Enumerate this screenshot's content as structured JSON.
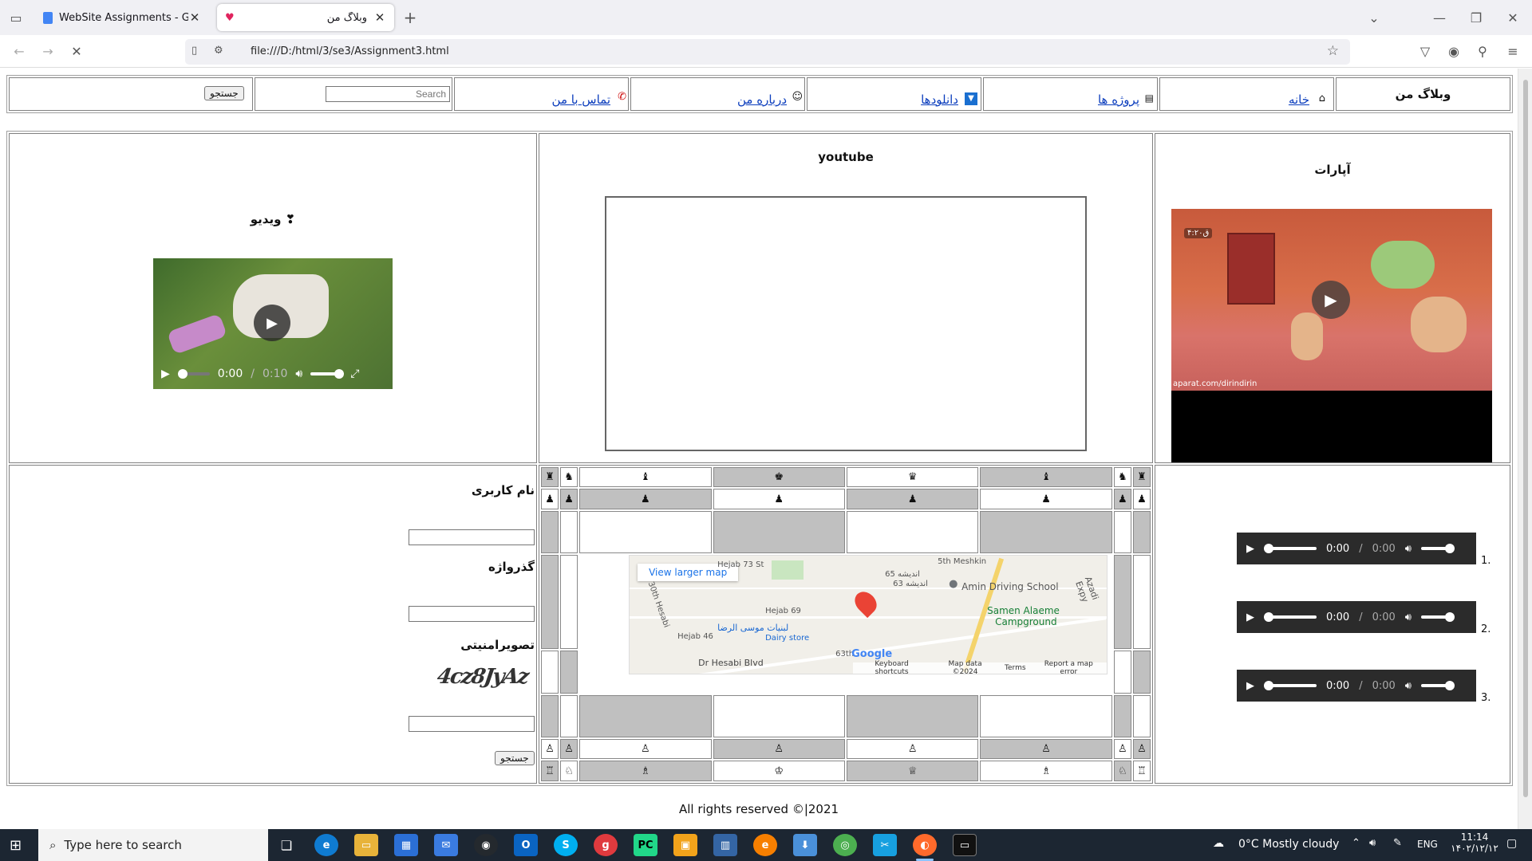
{
  "browser": {
    "tabs": [
      {
        "title": "WebSite Assignments - Google",
        "active": false,
        "icon": "google-docs-icon"
      },
      {
        "title": "وبلاگ من",
        "active": true,
        "icon": "heart-icon"
      }
    ],
    "url": "file:///D:/html/3/se3/Assignment3.html"
  },
  "nav": {
    "site_title": "وبلاگ من",
    "items": [
      {
        "label": "خانه",
        "icon": "house-icon"
      },
      {
        "label": "پروژه ها",
        "icon": "books-icon"
      },
      {
        "label": "دانلودها",
        "icon": "download-arrow-icon"
      },
      {
        "label": "درباره من",
        "icon": "face-icon"
      },
      {
        "label": "تماس با من",
        "icon": "phone-icon"
      }
    ],
    "search_placeholder": "Search",
    "search_button": "جستجو"
  },
  "media": {
    "aparat_title": "آپارات",
    "aparat_watermark": "aparat.com/dirindirin",
    "aparat_badge": "۴:۲۰ق",
    "youtube_title": "youtube",
    "video_title": "ویدیو",
    "video_time": "0:00",
    "video_duration": "0:10"
  },
  "audio": {
    "items": [
      {
        "num": "1.",
        "time": "0:00",
        "duration": "0:00"
      },
      {
        "num": "2.",
        "time": "0:00",
        "duration": "0:00"
      },
      {
        "num": "3.",
        "time": "0:00",
        "duration": "0:00"
      }
    ]
  },
  "chess": {
    "row_top_pieces": [
      "♜",
      "♞",
      "♝",
      "♚",
      "♛",
      "♝",
      "♞",
      "♜"
    ],
    "row_top_pawns": [
      "♟",
      "♟",
      "♟",
      "♟",
      "♟",
      "♟",
      "♟",
      "♟"
    ],
    "row_bottom_pawns": [
      "♙",
      "♙",
      "♙",
      "♙",
      "♙",
      "♙",
      "♙",
      "♙"
    ],
    "row_bottom_pieces": [
      "♖",
      "♘",
      "♗",
      "♔",
      "♕",
      "♗",
      "♘",
      "♖"
    ]
  },
  "map": {
    "view_larger": "View larger map",
    "labels": {
      "street1": "Hejab 73 St",
      "street2": "5th Meshkin",
      "persian1": "اندیشه 65",
      "persian2": "اندیشه 63",
      "school": "Amin Driving School",
      "camp1": "Samen Alaeme",
      "camp2": "Campground",
      "expy": "Azadi Expy",
      "hejab69": "Hejab 69",
      "hesabi": "30th Hesabi",
      "hejab46": "Hejab 46",
      "dairy_fa": "لبنیات موسی الرضا",
      "dairy": "Dairy store",
      "blvd": "Dr Hesabi Blvd",
      "n63": "63th"
    },
    "logo": "Google",
    "footer": [
      "Keyboard shortcuts",
      "Map data ©2024",
      "Terms",
      "Report a map error"
    ]
  },
  "form": {
    "username_label": "نام کاربری",
    "password_label": "گذرواژه",
    "captcha_label": "تصویرامنیتی",
    "captcha_text": "4cz8JyAz",
    "submit": "جستجو"
  },
  "footer": {
    "text": "All rights reserved ©|2021"
  },
  "taskbar": {
    "search_placeholder": "Type here to search",
    "weather": "0°C  Mostly cloudy",
    "lang": "ENG",
    "time": "11:14",
    "date": "۱۴۰۲/۱۲/۱۲"
  }
}
